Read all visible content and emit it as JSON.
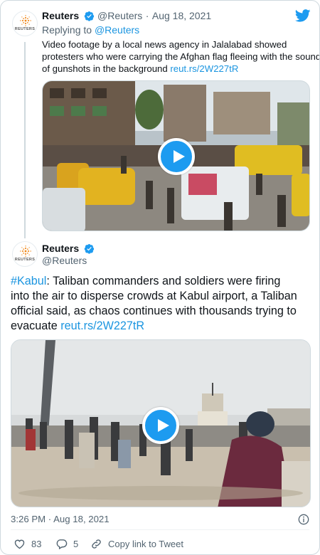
{
  "reply_tweet": {
    "author_name": "Reuters",
    "author_handle": "@Reuters",
    "separator": "·",
    "date": "Aug 18, 2021",
    "replying_prefix": "Replying to",
    "replying_to": "@Reuters",
    "text_lines": [
      "Video footage by a local news agency in Jalalabad showed",
      "protesters who were carrying the Afghan flag fleeing with the sound",
      "of gunshots in the background"
    ],
    "link": "reut.rs/2W227tR"
  },
  "main_tweet": {
    "author_name": "Reuters",
    "author_handle": "@Reuters",
    "hashtag": "#Kabul",
    "text_after_hashtag": ": Taliban commanders and soldiers were firing",
    "text_lines": [
      "into the air to disperse crowds at Kabul airport, a Taliban",
      "official said, as chaos continues with thousands trying to"
    ],
    "text_last": "evacuate",
    "link": "reut.rs/2W227tR",
    "time": "3:26 PM",
    "separator": "·",
    "date": "Aug 18, 2021"
  },
  "avatar_logo_text": "REUTERS",
  "actions": {
    "like_count": "83",
    "reply_count": "5",
    "copy_link_label": "Copy link to Tweet"
  },
  "icons": {
    "brand": "twitter-bird-icon",
    "verified": "verified-badge-icon",
    "info": "info-icon",
    "like": "heart-icon",
    "reply": "reply-bubble-icon",
    "copy": "link-icon",
    "play": "play-icon"
  },
  "colors": {
    "accent": "#1d9bf0",
    "link": "#1b95e0",
    "muted": "#536471",
    "border": "#cfd9de"
  }
}
